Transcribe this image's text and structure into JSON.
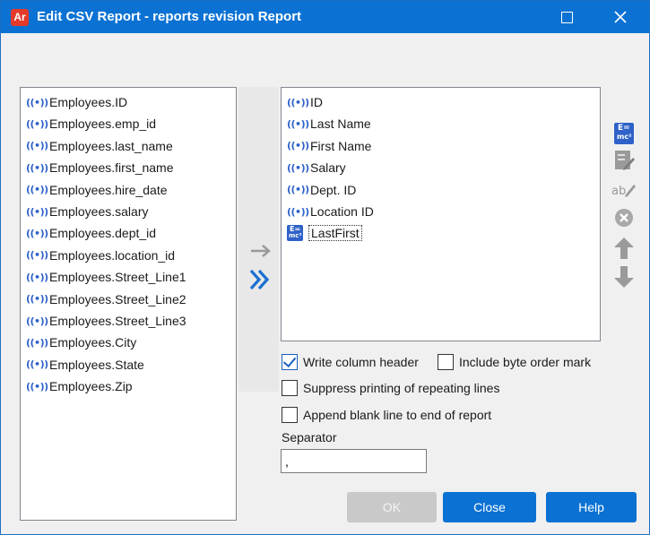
{
  "window": {
    "app_icon_text": "Ar",
    "title": "Edit CSV Report - reports revision Report"
  },
  "available_fields": [
    "Employees.ID",
    "Employees.emp_id",
    "Employees.last_name",
    "Employees.first_name",
    "Employees.hire_date",
    "Employees.salary",
    "Employees.dept_id",
    "Employees.location_id",
    "Employees.Street_Line1",
    "Employees.Street_Line2",
    "Employees.Street_Line3",
    "Employees.City",
    "Employees.State",
    "Employees.Zip"
  ],
  "report_columns": [
    {
      "label": "ID",
      "icon": "signal-icon"
    },
    {
      "label": "Last Name",
      "icon": "signal-icon"
    },
    {
      "label": "First Name",
      "icon": "signal-icon"
    },
    {
      "label": "Salary",
      "icon": "signal-icon"
    },
    {
      "label": "Dept. ID",
      "icon": "signal-icon"
    },
    {
      "label": "Location ID",
      "icon": "signal-icon"
    },
    {
      "label": "LastFirst",
      "icon": "formula-icon",
      "selected": true
    }
  ],
  "icons": {
    "signal_glyph": "((•))",
    "formula_e": "E=",
    "formula_mc": "mc²"
  },
  "options": {
    "write_column_header": {
      "label": "Write column header",
      "checked": true
    },
    "include_bom": {
      "label": "Include byte order mark",
      "checked": false
    },
    "suppress_repeating": {
      "label": "Suppress printing of repeating lines",
      "checked": false
    },
    "append_blank_line": {
      "label": "Append blank line to end of report",
      "checked": false
    }
  },
  "separator": {
    "label": "Separator",
    "value": ","
  },
  "buttons": {
    "ok": "OK",
    "close": "Close",
    "help": "Help"
  },
  "colors": {
    "titlebar": "#0b72d4",
    "accent": "#2f62c9",
    "button_primary": "#0b72d4",
    "button_disabled": "#c9c9c9"
  }
}
